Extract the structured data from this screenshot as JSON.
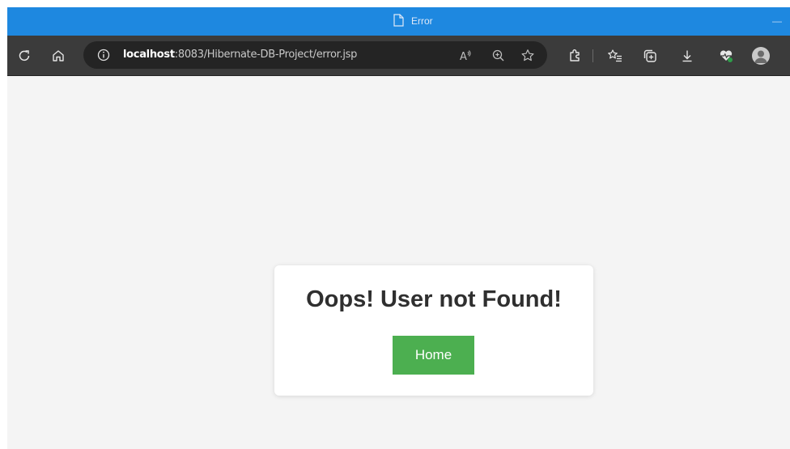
{
  "window": {
    "title": "Error",
    "minimize_glyph": "—",
    "titlebar_color": "#1e88e0"
  },
  "toolbar": {
    "refresh_icon": "refresh-icon",
    "home_icon": "home-icon",
    "address": {
      "info_icon": "info-icon",
      "host": "localhost",
      "path": ":8083/Hibernate-DB-Project/error.jsp"
    },
    "address_actions": [
      "read-aloud-icon",
      "zoom-icon",
      "favorite-star-icon"
    ],
    "right_actions": [
      "extensions-icon",
      "favorites-icon",
      "collections-icon",
      "downloads-icon",
      "browser-essentials-icon",
      "profile-avatar"
    ]
  },
  "page": {
    "background": "#f4f4f4",
    "error_message": "Oops! User not Found!",
    "home_button_label": "Home",
    "button_color": "#4caf50"
  }
}
